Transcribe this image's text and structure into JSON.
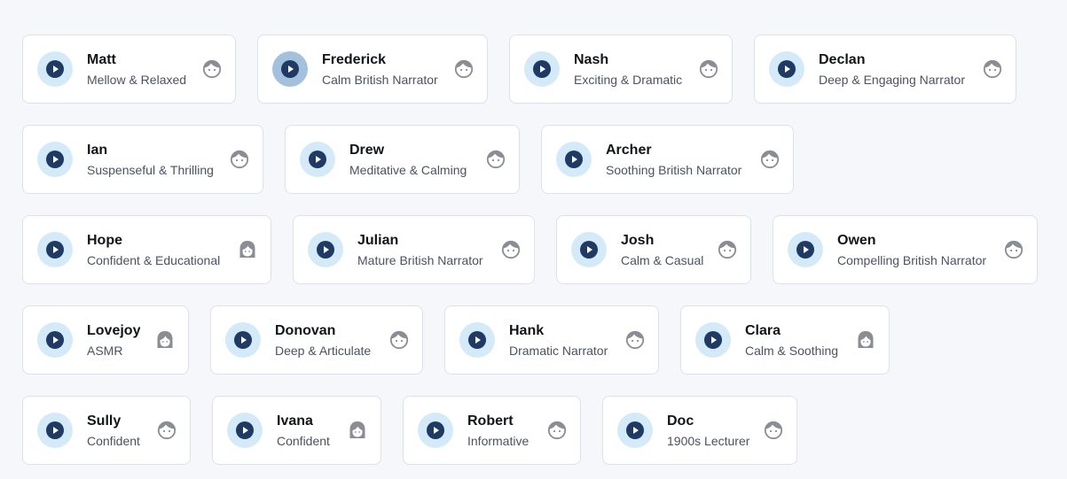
{
  "colors": {
    "accent": "#1f3a63",
    "play_bg": "#d5eaf8",
    "play_bg_active": "#a3c1dd",
    "avatar": "#8a8d93"
  },
  "rows": [
    [
      {
        "name": "Matt",
        "desc": "Mellow & Relaxed",
        "avatar": "male-face-icon"
      },
      {
        "name": "Frederick",
        "desc": "Calm British Narrator",
        "avatar": "male-face-icon",
        "active": true
      },
      {
        "name": "Nash",
        "desc": "Exciting & Dramatic",
        "avatar": "male-face-icon"
      },
      {
        "name": "Declan",
        "desc": "Deep & Engaging Narrator",
        "avatar": "male-face-icon"
      }
    ],
    [
      {
        "name": "Ian",
        "desc": "Suspenseful & Thrilling",
        "avatar": "male-face-icon"
      },
      {
        "name": "Drew",
        "desc": "Meditative & Calming",
        "avatar": "male-face-icon"
      },
      {
        "name": "Archer",
        "desc": "Soothing British Narrator",
        "avatar": "male-face-icon"
      }
    ],
    [
      {
        "name": "Hope",
        "desc": "Confident & Educational",
        "avatar": "female-face-icon"
      },
      {
        "name": "Julian",
        "desc": "Mature British Narrator",
        "avatar": "male-face-icon"
      },
      {
        "name": "Josh",
        "desc": "Calm & Casual",
        "avatar": "male-face-icon"
      },
      {
        "name": "Owen",
        "desc": "Compelling British Narrator",
        "avatar": "male-face-icon"
      }
    ],
    [
      {
        "name": "Lovejoy",
        "desc": "ASMR",
        "avatar": "female-face-icon"
      },
      {
        "name": "Donovan",
        "desc": "Deep & Articulate",
        "avatar": "male-face-icon"
      },
      {
        "name": "Hank",
        "desc": "Dramatic Narrator",
        "avatar": "male-face-icon"
      },
      {
        "name": "Clara",
        "desc": "Calm & Soothing",
        "avatar": "female-face-icon"
      }
    ],
    [
      {
        "name": "Sully",
        "desc": "Confident",
        "avatar": "male-face-icon"
      },
      {
        "name": "Ivana",
        "desc": "Confident",
        "avatar": "female-face-icon"
      },
      {
        "name": "Robert",
        "desc": "Informative",
        "avatar": "male-face-icon"
      },
      {
        "name": "Doc",
        "desc": "1900s Lecturer",
        "avatar": "male-face-icon"
      }
    ]
  ]
}
